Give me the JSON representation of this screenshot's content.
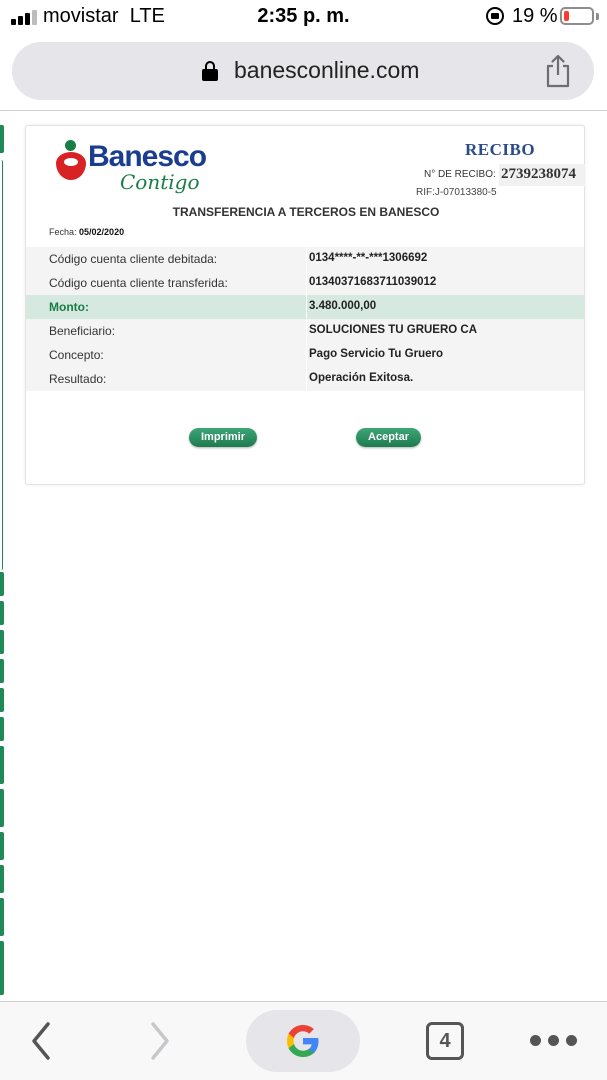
{
  "status_bar": {
    "carrier": "movistar",
    "network": "LTE",
    "time": "2:35 p. m.",
    "battery_percent": "19 %",
    "battery_level": 0.19,
    "battery_color": "#ff3b30"
  },
  "browser": {
    "url": "banesconline.com",
    "share_icon": "share-icon",
    "lock_icon": "padlock-icon"
  },
  "receipt": {
    "logo": {
      "brand": "Banesco",
      "tagline": "Contigo"
    },
    "title": "RECIBO",
    "number_label": "N° DE RECIBO:",
    "number_value": "2739238074",
    "rif": "RIF:J-07013380-5",
    "heading": "TRANSFERENCIA A TERCEROS EN BANESCO",
    "date_label": "Fecha:",
    "date_value": "05/02/2020",
    "rows": [
      {
        "label": "Código cuenta cliente debitada:",
        "value": "0134****-**-***1306692"
      },
      {
        "label": "Código cuenta cliente transferida:",
        "value": "01340371683711039012"
      },
      {
        "label": "Monto:",
        "value": "3.480.000,00"
      },
      {
        "label": "Beneficiario:",
        "value": "SOLUCIONES TU GRUERO CA"
      },
      {
        "label": "Concepto:",
        "value": "Pago Servicio Tu Gruero"
      },
      {
        "label": "Resultado:",
        "value": "Operación Exitosa."
      }
    ],
    "buttons": {
      "print": "Imprimir",
      "accept": "Aceptar"
    },
    "accent_color": "#1a7d45",
    "highlight_color": "#d6e9e0"
  },
  "toolbar": {
    "tabs_count": "4",
    "icons": [
      "back-icon",
      "forward-icon",
      "google-icon",
      "tabs-icon",
      "more-icon"
    ]
  }
}
